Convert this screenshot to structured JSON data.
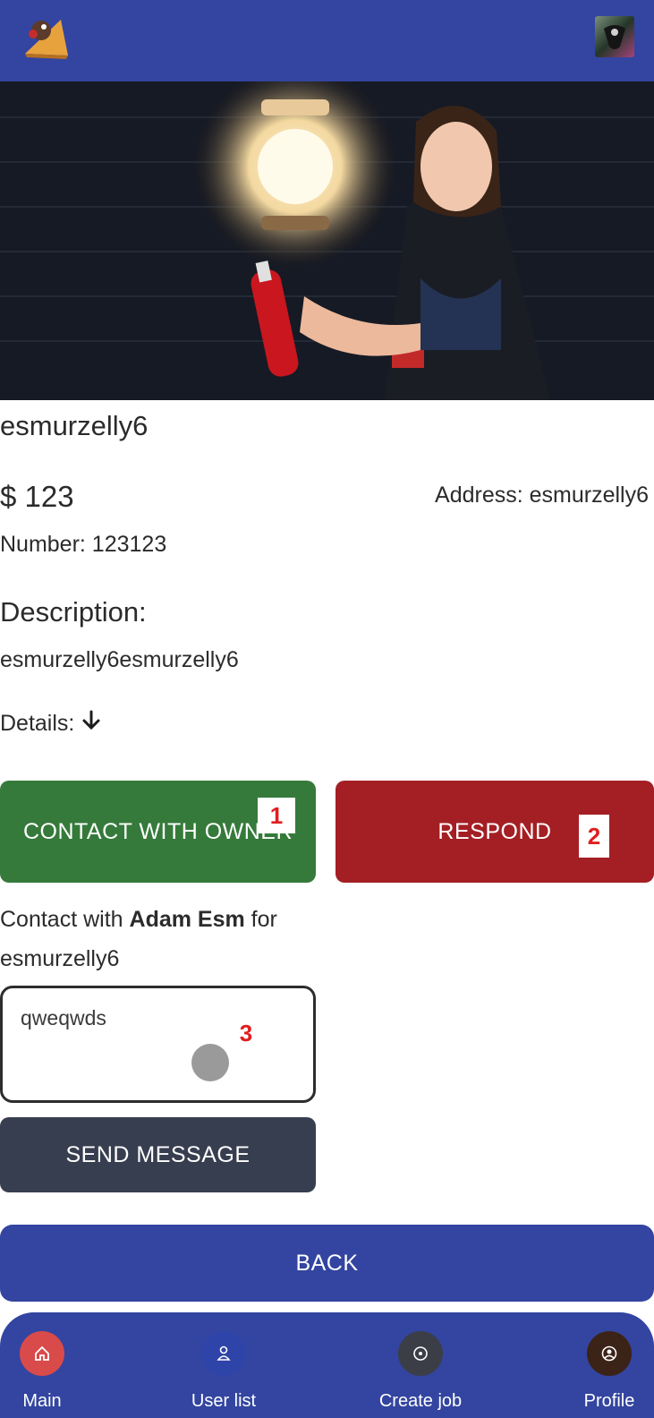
{
  "job": {
    "title": "esmurzelly6",
    "price": "$ 123",
    "address": "Address: esmurzelly6",
    "number": "Number: 123123",
    "description_heading": "Description:",
    "description": "esmurzelly6esmurzelly6",
    "details_label": "Details:"
  },
  "actions": {
    "contact_owner": "CONTACT WITH OWNER",
    "respond": "RESPOND",
    "send_message": "SEND MESSAGE",
    "back": "BACK"
  },
  "contact": {
    "prefix": "Contact with ",
    "owner_name": "Adam Esm",
    "suffix": " for",
    "job_name": "esmurzelly6"
  },
  "message": {
    "value": "qweqwds"
  },
  "markers": [
    "1",
    "2",
    "3"
  ],
  "nav": {
    "items": [
      {
        "label": "Main",
        "icon": "home-icon",
        "color": "#d94a4a"
      },
      {
        "label": "User list",
        "icon": "user-icon",
        "color": "#2f44a8"
      },
      {
        "label": "Create job",
        "icon": "target-icon",
        "color": "#3b3e47"
      },
      {
        "label": "Profile",
        "icon": "profile-icon",
        "color": "#3c2318"
      }
    ]
  },
  "colors": {
    "primary": "#3345a0",
    "contact": "#357a3a",
    "respond": "#a31f24",
    "send": "#373e4f"
  }
}
